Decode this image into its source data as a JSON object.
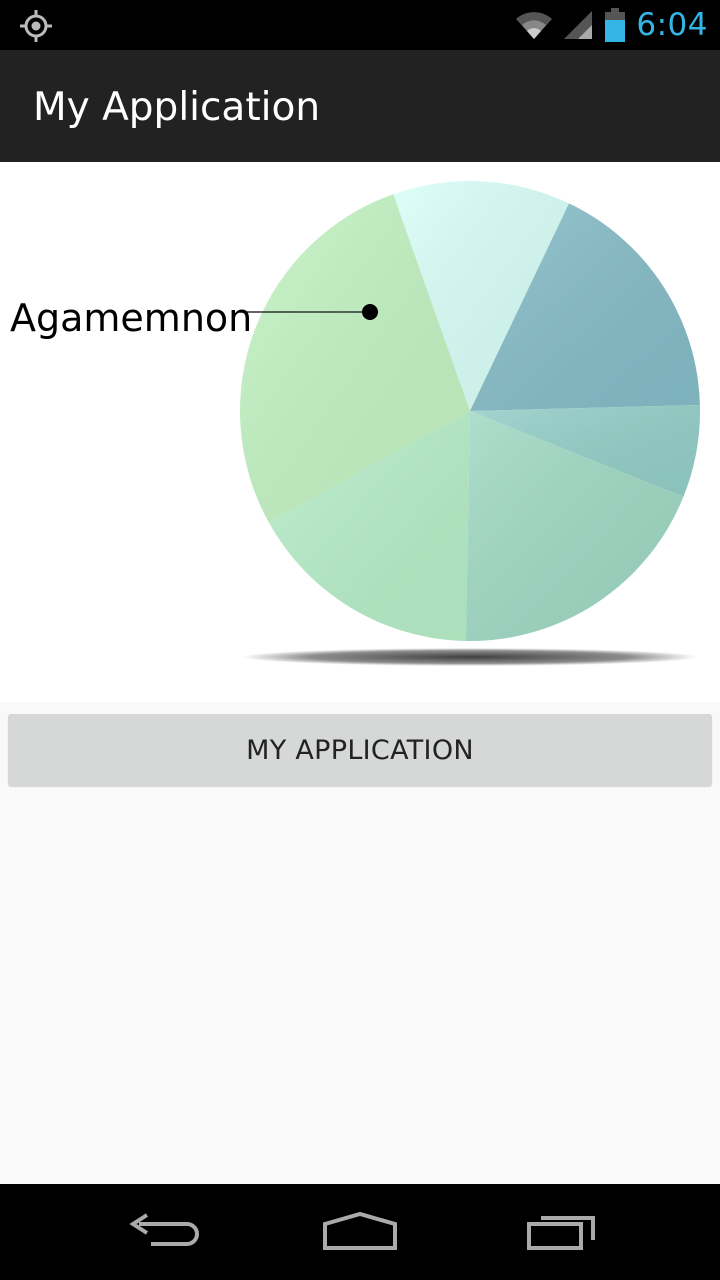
{
  "status_bar": {
    "time": "6:04",
    "icons": [
      "gps-icon",
      "wifi-icon",
      "signal-icon",
      "battery-icon"
    ],
    "time_color": "#33b5e5"
  },
  "action_bar": {
    "title": "My Application"
  },
  "chart_data": {
    "type": "pie",
    "slices": [
      {
        "name": "Agamemnon",
        "value": 12.5,
        "color": "#d9fff8"
      },
      {
        "value": 17.5,
        "color": "#86bdc8"
      },
      {
        "value": 6.5,
        "color": "#94cfc8"
      },
      {
        "value": 19.2,
        "color": "#a0d9c4"
      },
      {
        "value": 16.7,
        "color": "#b7eec9"
      },
      {
        "value": 27.6,
        "color": "#c3f3c3"
      }
    ],
    "start_angle_deg": -109.5,
    "highlighted_label": "Agamemnon"
  },
  "button": {
    "label": "MY APPLICATION"
  },
  "nav_bar": {
    "icons": [
      "back-icon",
      "home-icon",
      "recents-icon"
    ]
  }
}
